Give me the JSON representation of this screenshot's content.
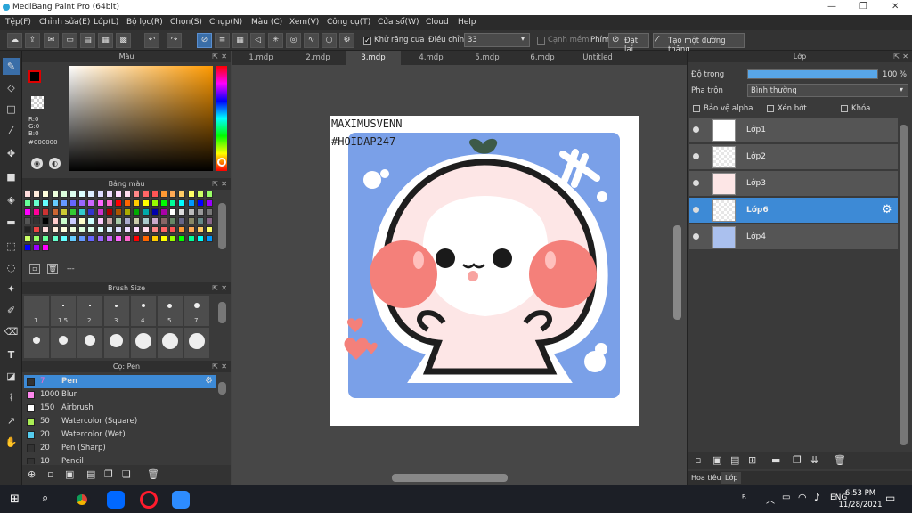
{
  "window": {
    "title": "MediBang Paint Pro (64bit)"
  },
  "menu": [
    "Tệp(F)",
    "Chỉnh sửa(E)",
    "Lớp(L)",
    "Bộ lọc(R)",
    "Chọn(S)",
    "Chụp(N)",
    "Màu (C)",
    "Xem(V)",
    "Công cụ(T)",
    "Cửa sổ(W)",
    "Cloud",
    "Help"
  ],
  "toolbar": {
    "antialias_label": "Khử răng cưa",
    "correction_label": "Điều chỉnh",
    "correction_value": "33",
    "margin_label": "Cạnh mềm",
    "key_label": "Phím",
    "reset_label": "Đặt lại",
    "straight_line_label": "Tạo một đường thẳng"
  },
  "color_panel": {
    "title": "Màu",
    "r": "R:0",
    "g": "G:0",
    "b": "B:0",
    "hex": "#000000"
  },
  "palette_panel": {
    "title": "Bảng màu",
    "footer": "---"
  },
  "brush_size_panel": {
    "title": "Brush Size",
    "sizes_row1": [
      "1",
      "1.5",
      "2",
      "3",
      "4",
      "5",
      "7"
    ]
  },
  "brush_panel": {
    "title": "Cọ: Pen",
    "brushes": [
      {
        "value": "7",
        "name": "Pen",
        "color": "#333333",
        "selected": true
      },
      {
        "value": "1000",
        "name": "Blur",
        "color": "#ff88ee",
        "selected": false
      },
      {
        "value": "150",
        "name": "Airbrush",
        "color": "#ffffff",
        "selected": false
      },
      {
        "value": "50",
        "name": "Watercolor (Square)",
        "color": "#aaee55",
        "selected": false
      },
      {
        "value": "20",
        "name": "Watercolor (Wet)",
        "color": "#55ccee",
        "selected": false
      },
      {
        "value": "20",
        "name": "Pen (Sharp)",
        "color": "#333333",
        "selected": false
      },
      {
        "value": "10",
        "name": "Pencil",
        "color": "#333333",
        "selected": false
      }
    ]
  },
  "tabs": [
    "1.mdp",
    "2.mdp",
    "3.mdp",
    "4.mdp",
    "5.mdp",
    "6.mdp",
    "Untitled"
  ],
  "artwork": {
    "line1": "MAXIMUSVENN",
    "line2": "#HOIDAP247"
  },
  "layer_panel": {
    "title": "Lớp",
    "opacity_label": "Độ trong",
    "opacity_value": "100 %",
    "opacity_fraction": 1.0,
    "blend_label": "Pha trộn",
    "blend_value": "Bình thường",
    "protect_alpha": "Bảo vệ alpha",
    "clipping": "Xén bớt",
    "lock": "Khóa",
    "layers": [
      {
        "name": "Lớp1",
        "selected": false
      },
      {
        "name": "Lớp2",
        "selected": false
      },
      {
        "name": "Lớp3",
        "selected": false
      },
      {
        "name": "Lớp6",
        "selected": true
      },
      {
        "name": "Lớp4",
        "selected": false
      }
    ],
    "bottom_tabs": [
      "Hoa tiêu",
      "Lớp"
    ]
  },
  "taskbar": {
    "time": "6:53 PM",
    "date": "11/28/2021",
    "lang": "ENG"
  }
}
